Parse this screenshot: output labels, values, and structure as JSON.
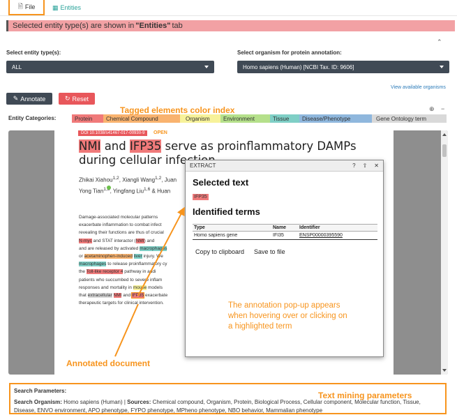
{
  "tabs": {
    "file": "File",
    "entities": "Entities"
  },
  "banner": {
    "prefix": "Selected entity type(s) are shown in",
    "highlight": "\"Entities\"",
    "suffix": "tab"
  },
  "entity_select": {
    "label": "Select entity type(s):",
    "value": "ALL"
  },
  "organism_select": {
    "label": "Select organism for protein annotation:",
    "value": "Homo sapiens (Human) [NCBI Tax. ID: 9606]"
  },
  "view_organisms_link": "View available organisms",
  "buttons": {
    "annotate": "Annotate",
    "reset": "Reset"
  },
  "callouts": {
    "tagged": "Tagged elements color index",
    "annotated_doc": "Annotated document",
    "text_mining": "Text mining parameters",
    "popup_note": "The annotation pop-up appears when hovering over or clicking on a highlighted term"
  },
  "entity_categories": {
    "label": "Entity Categories:",
    "items": [
      {
        "label": "Protein",
        "color": "#f07a7a"
      },
      {
        "label": "Chemical Compound",
        "color": "#f9b36f"
      },
      {
        "label": "Organism",
        "color": "#f7f29a"
      },
      {
        "label": "Environment",
        "color": "#b5e08b"
      },
      {
        "label": "Tissue",
        "color": "#7fcfc6"
      },
      {
        "label": "Disease/Phenotype",
        "color": "#8fb7dd"
      },
      {
        "label": "Gene Ontology term",
        "color": "#d9d9d9"
      }
    ]
  },
  "document": {
    "doi": "DOI 10.1038/s41467-017-00930-9",
    "open": "OPEN",
    "title": {
      "t1": "NMI",
      "t2": " and ",
      "t3": "IFP35",
      "t4": " serve as proinflammatory DAMPs",
      "t5": "during cellular inf",
      "t6": "ection"
    },
    "authors": {
      "line1": "Zhikai Xiahou",
      "line1b": ", Xiangli Wang",
      "line1c": ", Juan",
      "line2": "Yong Tian",
      "line2b": ", Yingfang Liu",
      "line2c": " & Huan"
    },
    "abstract": {
      "a1": "Damage-associated molecular patterns",
      "a2": "exacerbate inflammation to combat infect",
      "a3": "revealing their functions are thus of crucial",
      "a4a": "N-myc",
      "a4b": " and STAT interactor (",
      "a4c": "NMI",
      "a4d": ") and ",
      "a5a": "and are released by activated ",
      "a5b": "macrophages",
      "a6a": "or ",
      "a6b": "acetaminophen-induced",
      "a6c": " ",
      "a6d": "liver",
      "a6e": " injury. We",
      "a7a": "macrophages",
      "a7b": " to release proinflammatory cy",
      "a8a": "the ",
      "a8b": "Toll-like receptor 4",
      "a8c": " pathway in addi",
      "a9": "patients who succumbed to severe inflam",
      "a10": "responses and mortality in ",
      "a10b": "mouse",
      "a10c": " models",
      "a11a": "that ",
      "a11b": "extracellular",
      "a11c": " ",
      "a11d": "NMI",
      "a11e": " and ",
      "a11f": "IFP35",
      "a11g": " exacerbate",
      "a12": "therapeutic targets for clinical intervention."
    }
  },
  "popup": {
    "title": "EXTRACT",
    "controls": [
      "?",
      "⇧",
      "✕"
    ],
    "selected_heading": "Selected text",
    "selected_value": "IFP35",
    "identified_heading": "Identified terms",
    "table": {
      "headers": [
        "Type",
        "Name",
        "Identifier"
      ],
      "rows": [
        [
          "Homo sapiens gene",
          "IFI35",
          "ENSP00000395590"
        ]
      ]
    },
    "copy_label": "Copy to clipboard",
    "save_label": "Save to file"
  },
  "params": {
    "heading": "Search Parameters:",
    "organism_label": "Search Organism:",
    "organism_value": "Homo sapiens (Human)",
    "sources_label": "Sources:",
    "sources_value": "Chemical compound, Organism, Protein, Biological Process, Cellular component, Molecular function, Tissue, Disease, ENVO environment, APO phenotype, FYPO phenotype, MPheno phenotype, NBO behavior, Mammalian phenotype"
  }
}
